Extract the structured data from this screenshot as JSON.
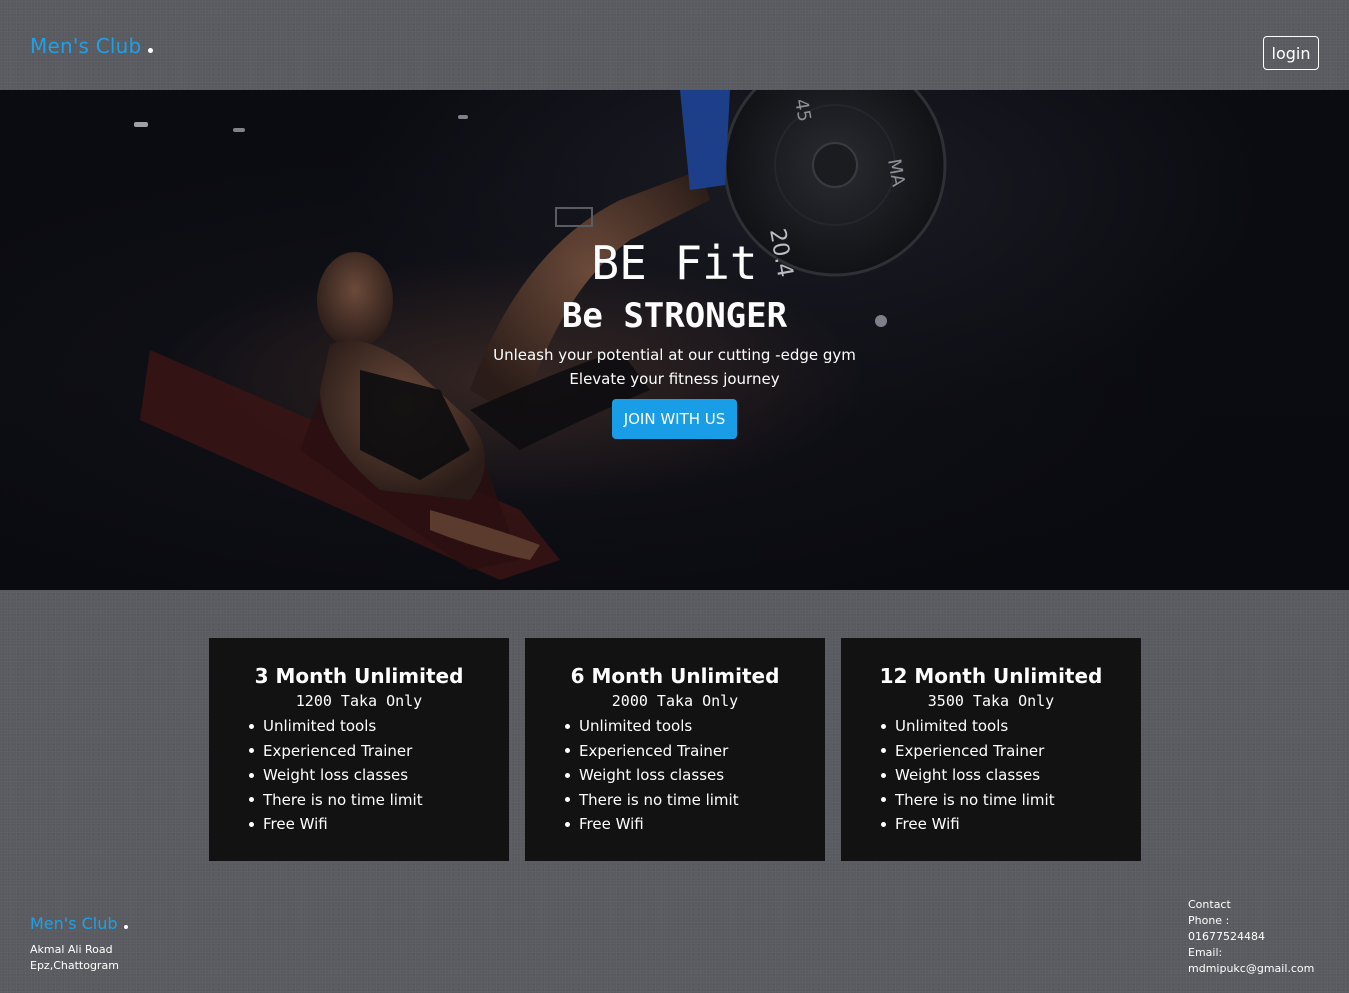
{
  "navbar": {
    "brand": "Men's Club",
    "login_label": "login"
  },
  "hero": {
    "title": "BE Fit",
    "subtitle": "Be STRONGER",
    "line1": "Unleash your potential at our cutting -edge gym",
    "line2": "Elevate your fitness journey",
    "cta_label": "JOIN WITH US",
    "plate_text": [
      "45",
      "20.4",
      "MA"
    ]
  },
  "plans": [
    {
      "title": "3 Month Unlimited",
      "price": "1200 Taka Only",
      "features": [
        "Unlimited tools",
        "Experienced Trainer",
        "Weight loss classes",
        "There is no time limit",
        "Free Wifi"
      ]
    },
    {
      "title": "6 Month Unlimited",
      "price": "2000 Taka Only",
      "features": [
        "Unlimited tools",
        "Experienced Trainer",
        "Weight loss classes",
        "There is no time limit",
        "Free Wifi"
      ]
    },
    {
      "title": "12 Month Unlimited",
      "price": "3500 Taka Only",
      "features": [
        "Unlimited tools",
        "Experienced Trainer",
        "Weight loss classes",
        "There is no time limit",
        "Free Wifi"
      ]
    }
  ],
  "footer": {
    "brand": "Men's Club",
    "address_line1": "Akmal Ali Road",
    "address_line2": "Epz,Chattogram",
    "contact_label": "Contact",
    "phone_label": "Phone :",
    "phone": "01677524484",
    "email_label": "Email:",
    "email": "mdmipukc@gmail.com"
  },
  "colors": {
    "accent": "#1ea0e8",
    "button": "#189de6",
    "card_bg": "#121212",
    "page_bg": "#5a5b60",
    "hero_bg": "#0b0c12"
  }
}
